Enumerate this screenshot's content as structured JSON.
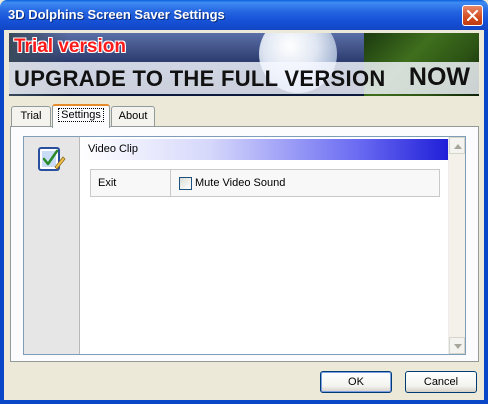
{
  "window": {
    "title": "3D Dolphins Screen Saver Settings"
  },
  "banner": {
    "trial_label": "Trial version",
    "upgrade_text": "UPGRADE TO THE FULL VERSION",
    "now_text": "NOW"
  },
  "tabs": [
    {
      "label": "Trial",
      "active": false
    },
    {
      "label": "Settings",
      "active": true
    },
    {
      "label": "About",
      "active": false
    }
  ],
  "settings": {
    "section_title": "Video Clip",
    "option": {
      "label": "Exit",
      "checkbox_label": "Mute Video Sound",
      "checked": false
    }
  },
  "buttons": {
    "ok": "OK",
    "cancel": "Cancel"
  },
  "colors": {
    "title_bar": "#1651d6",
    "header_gradient_end": "#1f1ed8",
    "active_tab_accent": "#e68b2c"
  }
}
